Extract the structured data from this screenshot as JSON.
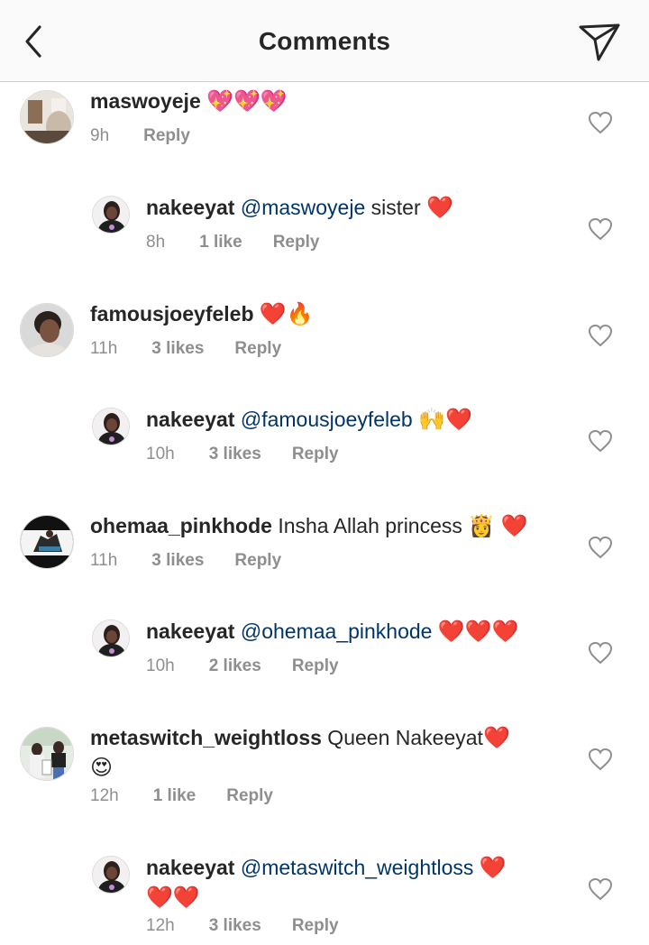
{
  "header": {
    "title": "Comments"
  },
  "comments": [
    {
      "user": "maswoyeje",
      "mention": "",
      "text": "",
      "emoji": "💖💖💖",
      "time": "9h",
      "likes": "",
      "reply": "Reply"
    },
    {
      "user": "nakeeyat",
      "mention": "@maswoyeje",
      "text": " sister ",
      "emoji": "❤️",
      "time": "8h",
      "likes": "1 like",
      "reply": "Reply"
    },
    {
      "user": "famousjoeyfeleb",
      "mention": "",
      "text": " ",
      "emoji": "❤️🔥",
      "time": "11h",
      "likes": "3 likes",
      "reply": "Reply"
    },
    {
      "user": "nakeeyat",
      "mention": "@famousjoeyfeleb",
      "text": " ",
      "emoji": "🙌❤️",
      "time": "10h",
      "likes": "3 likes",
      "reply": "Reply"
    },
    {
      "user": "ohemaa_pinkhode",
      "mention": "",
      "text": " Insha Allah princess ",
      "emoji": "👸 ❤️",
      "time": "11h",
      "likes": "3 likes",
      "reply": "Reply"
    },
    {
      "user": "nakeeyat",
      "mention": "@ohemaa_pinkhode",
      "text": " ",
      "emoji": "❤️❤️❤️",
      "time": "10h",
      "likes": "2 likes",
      "reply": "Reply"
    },
    {
      "user": "metaswitch_weightloss",
      "mention": "",
      "text": " Queen Nakeeyat",
      "emoji": "❤️ 😍",
      "time": "12h",
      "likes": "1 like",
      "reply": "Reply"
    },
    {
      "user": "nakeeyat",
      "mention": "@metaswitch_weightloss",
      "text": " ",
      "emoji": "❤️ ❤️❤️",
      "time": "12h",
      "likes": "3 likes",
      "reply": "Reply"
    }
  ]
}
